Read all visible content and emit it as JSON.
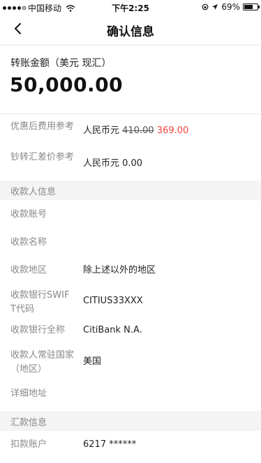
{
  "status_bar": {
    "carrier": "中国移动",
    "time": "下午2:25",
    "battery": "69%",
    "battery_level": 0.69
  },
  "nav": {
    "back_icon": "chevron-left-icon",
    "title": "确认信息"
  },
  "amount": {
    "label": "转账金额（美元 现汇）",
    "value": "50,000.00"
  },
  "fees": [
    {
      "label": "优惠后费用参考",
      "currency": "人民币元",
      "original": "410.00",
      "discounted": "369.00"
    },
    {
      "label": "钞转汇差价参考",
      "value": "人民币元 0.00"
    }
  ],
  "payee": {
    "section_title": "收款人信息",
    "rows": [
      {
        "label": "收款账号",
        "value": ""
      },
      {
        "label": "收款名称",
        "value": ""
      },
      {
        "label": "收款地区",
        "value": "除上述以外的地区"
      },
      {
        "label": "收款银行SWIFT代码",
        "value": "CITIUS33XXX"
      },
      {
        "label": "收款银行全称",
        "value": "CitiBank N.A."
      },
      {
        "label": "收款人常驻国家（地区）",
        "value": "美国"
      },
      {
        "label": "详细地址",
        "value": ""
      }
    ]
  },
  "remitter": {
    "section_title": "汇款信息",
    "rows": [
      {
        "label": "扣款账户",
        "value": "6217 ******"
      }
    ]
  },
  "colors": {
    "accent_red": "#e8423b",
    "section_bg": "#f4f4f4"
  }
}
